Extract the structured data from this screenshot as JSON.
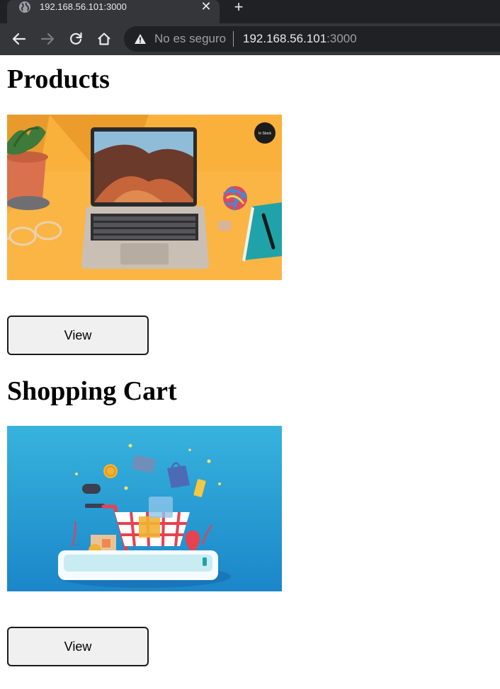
{
  "browser": {
    "tab_title": "192.168.56.101:3000",
    "close_glyph": "✕",
    "new_tab_glyph": "+",
    "security_label": "No es seguro",
    "url_host": "192.168.56.101",
    "url_port": ":3000"
  },
  "sections": [
    {
      "title": "Products",
      "image": {
        "icon": "laptop-desk-photo",
        "badge_text": "In Stock"
      },
      "button_label": "View"
    },
    {
      "title": "Shopping Cart",
      "image": {
        "icon": "shopping-cart-illustration"
      },
      "button_label": "View"
    }
  ],
  "colors": {
    "chrome_dark": "#202124",
    "chrome_mid": "#35363a",
    "products_bg": "#f9b13c",
    "cart_bg": "#2e9fd6"
  }
}
